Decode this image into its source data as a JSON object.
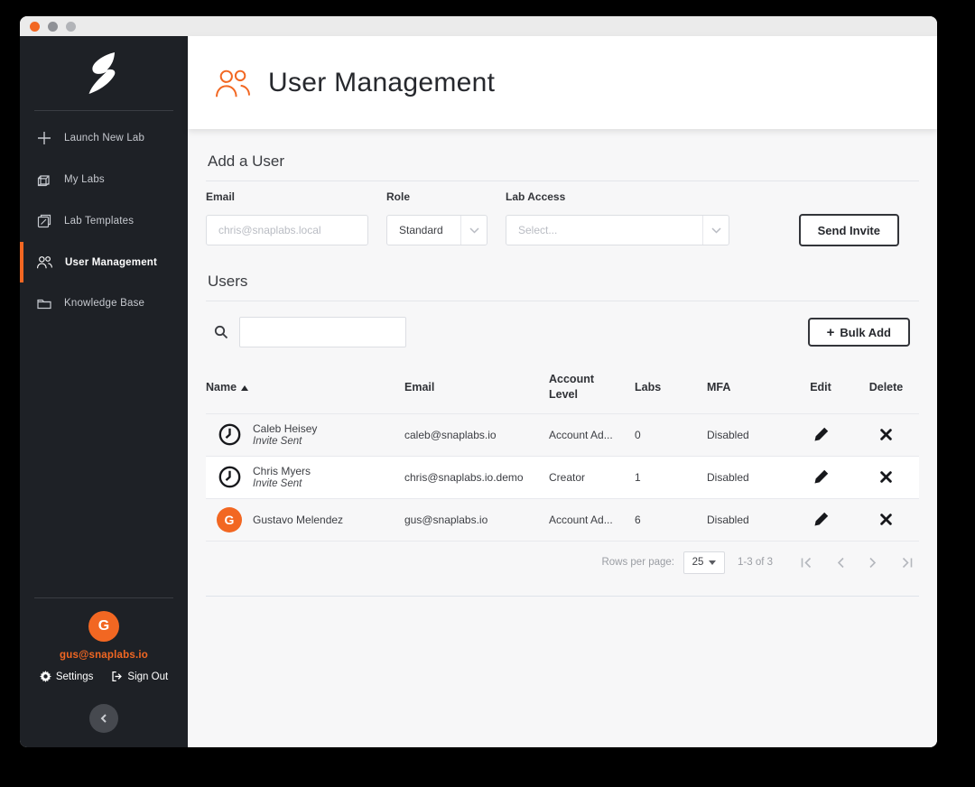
{
  "colors": {
    "accent": "#f26722",
    "sidebar_bg": "#1e2126",
    "content_bg": "#f7f7f8"
  },
  "icons": {
    "plus": "+"
  },
  "sidebar": {
    "items": [
      {
        "label": "Launch New Lab"
      },
      {
        "label": "My Labs"
      },
      {
        "label": "Lab Templates"
      },
      {
        "label": "User Management"
      },
      {
        "label": "Knowledge Base"
      }
    ],
    "user": {
      "avatar_letter": "G",
      "email": "gus@snaplabs.io",
      "settings_label": "Settings",
      "sign_out_label": "Sign Out"
    }
  },
  "header": {
    "title": "User Management"
  },
  "add_user": {
    "section_title": "Add a User",
    "email_label": "Email",
    "email_placeholder": "chris@snaplabs.local",
    "role_label": "Role",
    "role_value": "Standard",
    "lab_access_label": "Lab Access",
    "lab_access_value": "Select...",
    "send_invite_label": "Send Invite"
  },
  "users": {
    "section_title": "Users",
    "bulk_add_label": "Bulk Add",
    "columns": [
      "Name",
      "Email",
      "Account Level",
      "Labs",
      "MFA",
      "Edit",
      "Delete"
    ],
    "rows": [
      {
        "name": "Caleb Heisey",
        "status": "Invite Sent",
        "email": "caleb@snaplabs.io",
        "account_level": "Account Ad...",
        "labs": "0",
        "mfa": "Disabled"
      },
      {
        "name": "Chris Myers",
        "status": "Invite Sent",
        "email": "chris@snaplabs.io.demo",
        "account_level": "Creator",
        "labs": "1",
        "mfa": "Disabled"
      },
      {
        "name": "Gustavo Melendez",
        "status": "",
        "email": "gus@snaplabs.io",
        "account_level": "Account Ad...",
        "labs": "6",
        "mfa": "Disabled",
        "avatar_letter": "G"
      }
    ],
    "pagination": {
      "rows_per_page_label": "Rows per page:",
      "rows_per_page_value": "25",
      "range_label": "1-3 of 3"
    }
  }
}
